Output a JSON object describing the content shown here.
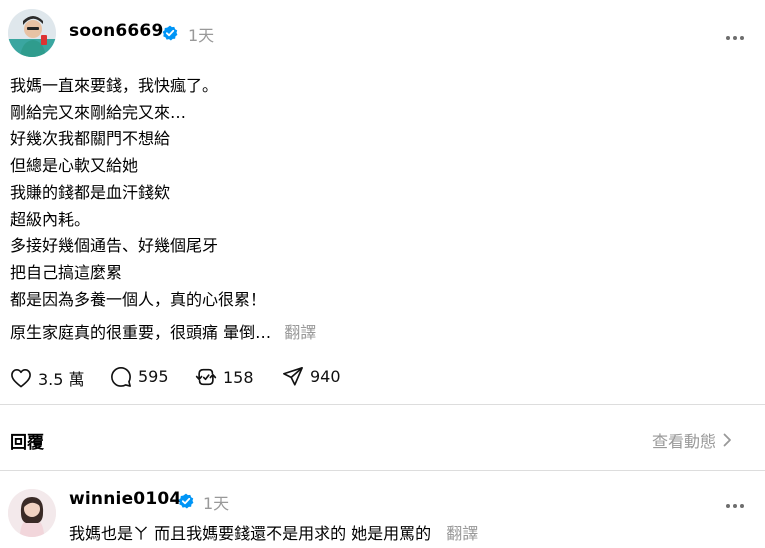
{
  "post": {
    "username": "soon6669",
    "time": "1天",
    "more_icon": "more-horizontal-icon",
    "lines": [
      "我媽一直來要錢，我快瘋了。",
      "剛給完又來剛給完又來…",
      "好幾次我都關門不想給",
      "但總是心軟又給她",
      "我賺的錢都是血汗錢欸",
      "超級內耗。",
      "多接好幾個通告、好幾個尾牙",
      "把自己搞這麼累",
      "都是因為多養一個人，真的心很累！"
    ],
    "last_line": "原生家庭真的很重要，很頭痛 暈倒…",
    "translate_label": "翻譯",
    "actions": {
      "likes": "3.5 萬",
      "comments": "595",
      "reposts": "158",
      "shares": "940"
    }
  },
  "replies_section": {
    "heading": "回覆",
    "view_activity": "查看動態"
  },
  "reply": {
    "username": "winnie0104",
    "time": "1天",
    "text": "我媽也是ㄚ 而且我媽要錢還不是用求的 她是用罵的",
    "translate_label": "翻譯"
  },
  "colors": {
    "verified": "#0095f6",
    "muted": "#999999",
    "divider": "#dddddd"
  }
}
